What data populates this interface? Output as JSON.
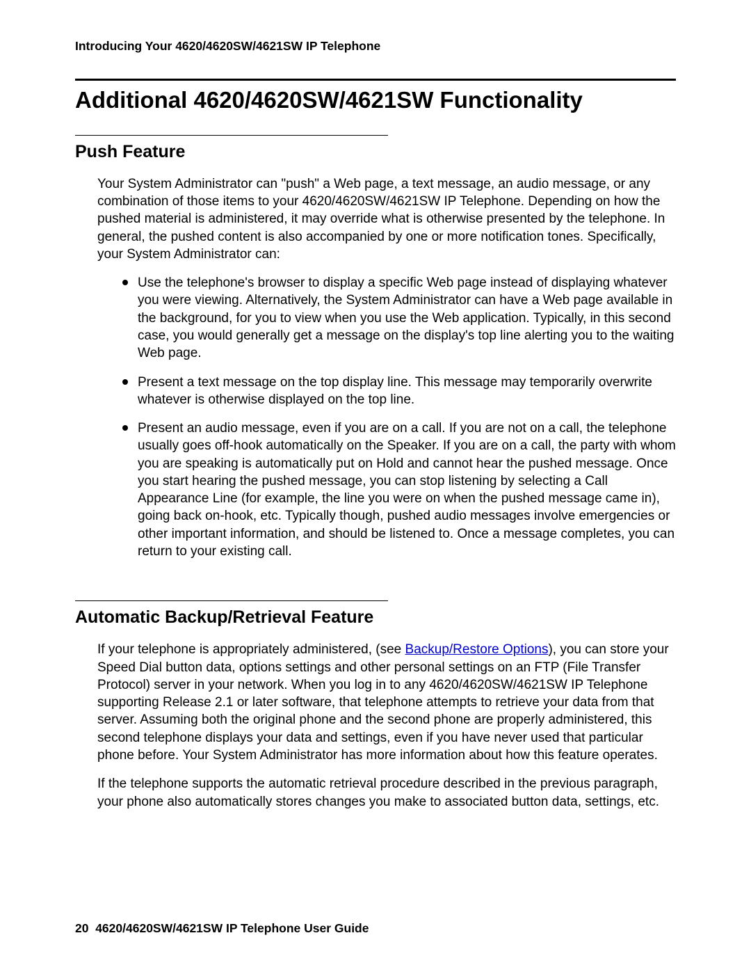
{
  "header": {
    "running_title": "Introducing Your 4620/4620SW/4621SW IP Telephone"
  },
  "main": {
    "title": "Additional 4620/4620SW/4621SW Functionality",
    "sections": [
      {
        "heading": "Push Feature",
        "intro": "Your System Administrator can \"push\" a Web page, a text message, an audio message, or any combination of those items to your 4620/4620SW/4621SW IP Telephone. Depending on how the pushed material is administered, it may override what is otherwise presented by the telephone. In general, the pushed content is also accompanied by one or more notification tones. Specifically, your System Administrator can:",
        "bullets": [
          "Use the telephone's browser to display a specific Web page instead of displaying whatever you were viewing. Alternatively, the System Administrator can have a Web page available in the background, for you to view when you use the Web application. Typically, in this second case, you would generally get a message on the display's top line alerting you to the waiting Web page.",
          "Present a text message on the top display line. This message may temporarily overwrite whatever is otherwise displayed on the top line.",
          "Present an audio message, even if you are on a call. If you are not on a call, the telephone usually goes off-hook automatically on the Speaker. If you are on a call, the party with whom you are speaking is automatically put on Hold and cannot hear the pushed message. Once you start hearing the pushed message, you can stop listening by selecting a Call Appearance Line (for example, the line you were on when the pushed message came in), going back on-hook, etc. Typically though, pushed audio messages involve emergencies or other important information, and should be listened to. Once a message completes, you can return to your existing call."
        ]
      },
      {
        "heading": "Automatic Backup/Retrieval Feature",
        "para_pre_link": "If your telephone is appropriately administered, (see ",
        "link_text": "Backup/Restore Options",
        "para_post_link": "), you can store your Speed Dial button data, options settings and other personal settings on an FTP (File Transfer Protocol) server in your network. When you log in to any 4620/4620SW/4621SW IP Telephone supporting Release 2.1 or later software, that telephone attempts to retrieve your data from that server. Assuming both the original phone and the second phone are properly administered, this second telephone displays your data and settings, even if you have never used that particular phone before. Your System Administrator has more information about how this feature operates.",
        "para2": "If the telephone supports the automatic retrieval procedure described in the previous paragraph, your phone also automatically stores changes you make to associated button data, settings, etc."
      }
    ]
  },
  "footer": {
    "page_number": "20",
    "doc_title": "4620/4620SW/4621SW IP Telephone User Guide"
  }
}
